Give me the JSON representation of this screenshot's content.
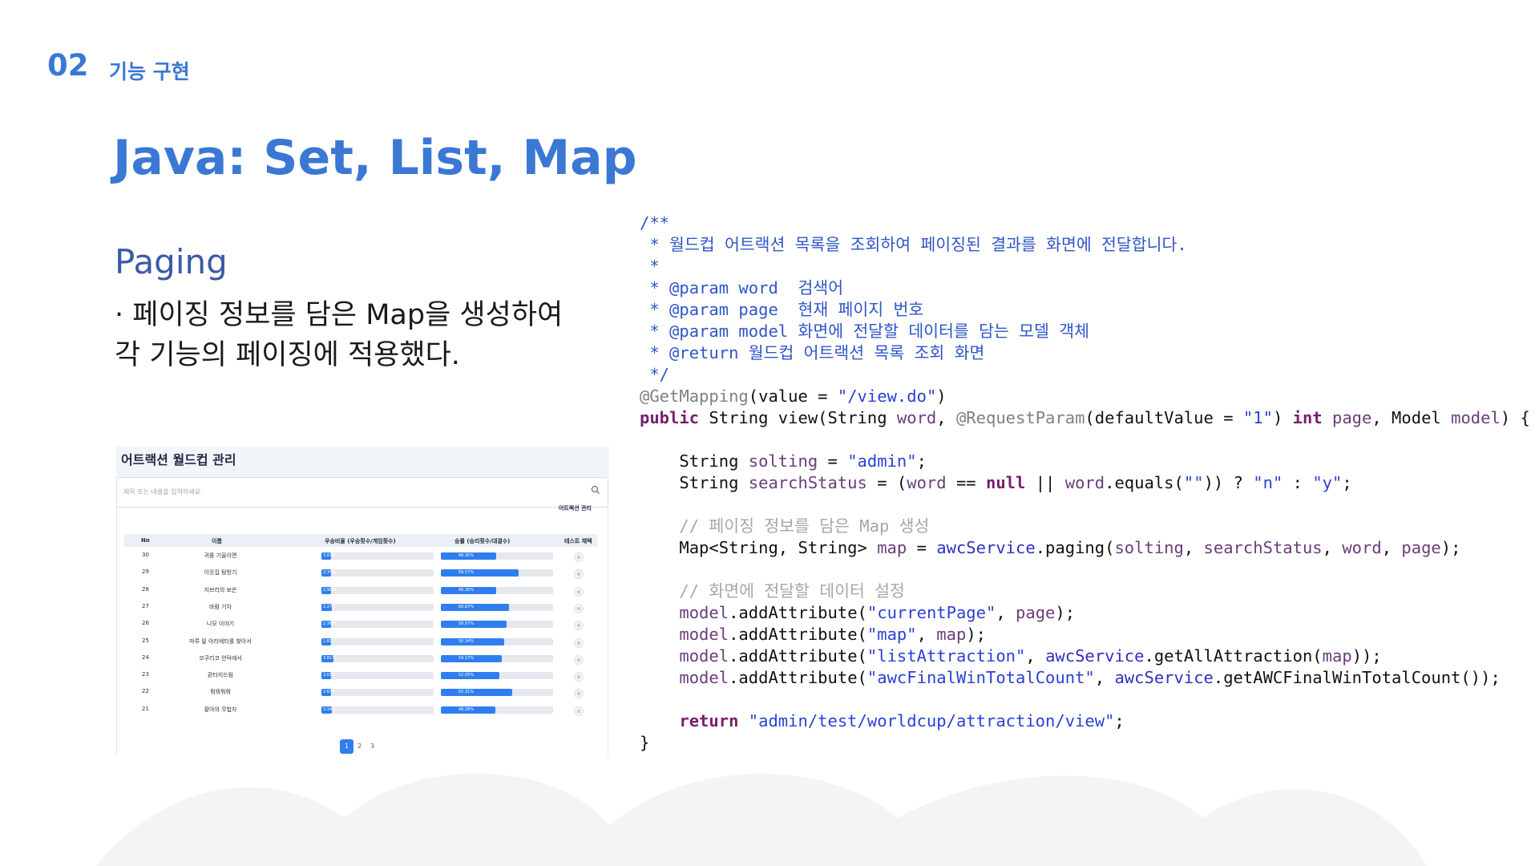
{
  "header": {
    "section_number": "02",
    "section_title": "기능 구현"
  },
  "title": "Java: Set, List, Map",
  "subtitle": "Paging",
  "description": {
    "line1": "· 페이징 정보를 담은 Map을 생성하여",
    "line2": "각 기능의 페이징에 적용했다."
  },
  "screenshot": {
    "title": "어트랙션 월드컵 관리",
    "search_placeholder": "제목 또는 내용을 입력하세요.",
    "manage_label": "어트랙션 관리",
    "columns": [
      "No",
      "이름",
      "우승비율 (우승횟수/게임횟수)",
      "승률 (승리횟수/대결수)",
      "테스트 채택"
    ],
    "rows": [
      {
        "no": "30",
        "name": "귀를 기울이면",
        "win_label": "3.07%",
        "win": 3.07,
        "rate_label": "49.30%",
        "rate": 49.3
      },
      {
        "no": "29",
        "name": "이웃집 탐방기",
        "win_label": "2.35%",
        "win": 2.35,
        "rate_label": "69.57%",
        "rate": 69.57
      },
      {
        "no": "28",
        "name": "지브리의 보은",
        "win_label": "2.98%",
        "win": 2.98,
        "rate_label": "49.30%",
        "rate": 49.3
      },
      {
        "no": "27",
        "name": "바람 기차",
        "win_label": "3.27%",
        "win": 3.27,
        "rate_label": "60.87%",
        "rate": 60.87
      },
      {
        "no": "26",
        "name": "니모 이야기",
        "win_label": "2.36%",
        "win": 2.36,
        "rate_label": "58.57%",
        "rate": 58.57
      },
      {
        "no": "25",
        "name": "마루 밑 아리에티를 찾아서",
        "win_label": "1.82",
        "win": 1.82,
        "rate_label": "56.34%",
        "rate": 56.34
      },
      {
        "no": "24",
        "name": "코쿠리코 언덕에서",
        "win_label": "3.81%",
        "win": 3.81,
        "rate_label": "54.17%",
        "rate": 54.17
      },
      {
        "no": "23",
        "name": "환타지드림",
        "win_label": "3.01%",
        "win": 3.01,
        "rate_label": "52.05%",
        "rate": 52.05
      },
      {
        "no": "22",
        "name": "뭐뭐뭐뭐",
        "win_label": "2.65%",
        "win": 2.65,
        "rate_label": "63.31%",
        "rate": 63.31
      },
      {
        "no": "21",
        "name": "황야의 무법자",
        "win_label": "3.34%",
        "win": 3.34,
        "rate_label": "48.28%",
        "rate": 48.28
      }
    ],
    "pages": [
      "1",
      "2",
      "3"
    ],
    "current_page": "1"
  },
  "code_lines": [
    [
      {
        "c": "cm",
        "t": "/**"
      }
    ],
    [
      {
        "c": "cm",
        "t": " * 월드컵 어트랙션 목록을 조회하여 페이징된 결과를 화면에 전달합니다."
      }
    ],
    [
      {
        "c": "cm",
        "t": " *"
      }
    ],
    [
      {
        "c": "cm",
        "t": " * @param word  검색어"
      }
    ],
    [
      {
        "c": "cm",
        "t": " * @param page  현재 페이지 번호"
      }
    ],
    [
      {
        "c": "cm",
        "t": " * @param model 화면에 전달할 데이터를 담는 모델 객체"
      }
    ],
    [
      {
        "c": "cm",
        "t": " * @return 월드컵 어트랙션 목록 조회 화면"
      }
    ],
    [
      {
        "c": "cm",
        "t": " */"
      }
    ],
    [
      {
        "c": "an",
        "t": "@GetMapping"
      },
      {
        "c": "",
        "t": "(value = "
      },
      {
        "c": "st",
        "t": "\"/view.do\""
      },
      {
        "c": "",
        "t": ")"
      }
    ],
    [
      {
        "c": "kw",
        "t": "public"
      },
      {
        "c": "",
        "t": " String view(String "
      },
      {
        "c": "va",
        "t": "word"
      },
      {
        "c": "",
        "t": ", "
      },
      {
        "c": "an",
        "t": "@RequestParam"
      },
      {
        "c": "",
        "t": "(defaultValue = "
      },
      {
        "c": "st",
        "t": "\"1\""
      },
      {
        "c": "",
        "t": ") "
      },
      {
        "c": "kw",
        "t": "int"
      },
      {
        "c": "",
        "t": " "
      },
      {
        "c": "va",
        "t": "page"
      },
      {
        "c": "",
        "t": ", Model "
      },
      {
        "c": "va",
        "t": "model"
      },
      {
        "c": "",
        "t": ") {"
      }
    ],
    [
      {
        "c": "",
        "t": ""
      }
    ],
    [
      {
        "c": "",
        "t": "    String "
      },
      {
        "c": "va",
        "t": "solting"
      },
      {
        "c": "",
        "t": " = "
      },
      {
        "c": "st",
        "t": "\"admin\""
      },
      {
        "c": "",
        "t": ";"
      }
    ],
    [
      {
        "c": "",
        "t": "    String "
      },
      {
        "c": "va",
        "t": "searchStatus"
      },
      {
        "c": "",
        "t": " = ("
      },
      {
        "c": "va",
        "t": "word"
      },
      {
        "c": "",
        "t": " == "
      },
      {
        "c": "kw",
        "t": "null"
      },
      {
        "c": "",
        "t": " || "
      },
      {
        "c": "va",
        "t": "word"
      },
      {
        "c": "",
        "t": ".equals("
      },
      {
        "c": "st",
        "t": "\"\""
      },
      {
        "c": "",
        "t": ")) ? "
      },
      {
        "c": "st",
        "t": "\"n\""
      },
      {
        "c": "",
        "t": " : "
      },
      {
        "c": "st",
        "t": "\"y\""
      },
      {
        "c": "",
        "t": ";"
      }
    ],
    [
      {
        "c": "",
        "t": ""
      }
    ],
    [
      {
        "c": "gc",
        "t": "    // 페이징 정보를 담은 Map 생성"
      }
    ],
    [
      {
        "c": "",
        "t": "    Map<String, String> "
      },
      {
        "c": "va",
        "t": "map"
      },
      {
        "c": "",
        "t": " = "
      },
      {
        "c": "fi",
        "t": "awcService"
      },
      {
        "c": "",
        "t": ".paging("
      },
      {
        "c": "va",
        "t": "solting"
      },
      {
        "c": "",
        "t": ", "
      },
      {
        "c": "va",
        "t": "searchStatus"
      },
      {
        "c": "",
        "t": ", "
      },
      {
        "c": "va",
        "t": "word"
      },
      {
        "c": "",
        "t": ", "
      },
      {
        "c": "va",
        "t": "page"
      },
      {
        "c": "",
        "t": ");"
      }
    ],
    [
      {
        "c": "",
        "t": ""
      }
    ],
    [
      {
        "c": "gc",
        "t": "    // 화면에 전달할 데이터 설정"
      }
    ],
    [
      {
        "c": "va",
        "t": "    model"
      },
      {
        "c": "",
        "t": ".addAttribute("
      },
      {
        "c": "st",
        "t": "\"currentPage\""
      },
      {
        "c": "",
        "t": ", "
      },
      {
        "c": "va",
        "t": "page"
      },
      {
        "c": "",
        "t": ");"
      }
    ],
    [
      {
        "c": "va",
        "t": "    model"
      },
      {
        "c": "",
        "t": ".addAttribute("
      },
      {
        "c": "st",
        "t": "\"map\""
      },
      {
        "c": "",
        "t": ", "
      },
      {
        "c": "va",
        "t": "map"
      },
      {
        "c": "",
        "t": ");"
      }
    ],
    [
      {
        "c": "va",
        "t": "    model"
      },
      {
        "c": "",
        "t": ".addAttribute("
      },
      {
        "c": "st",
        "t": "\"listAttraction\""
      },
      {
        "c": "",
        "t": ", "
      },
      {
        "c": "fi",
        "t": "awcService"
      },
      {
        "c": "",
        "t": ".getAllAttraction("
      },
      {
        "c": "va",
        "t": "map"
      },
      {
        "c": "",
        "t": "));"
      }
    ],
    [
      {
        "c": "va",
        "t": "    model"
      },
      {
        "c": "",
        "t": ".addAttribute("
      },
      {
        "c": "st",
        "t": "\"awcFinalWinTotalCount\""
      },
      {
        "c": "",
        "t": ", "
      },
      {
        "c": "fi",
        "t": "awcService"
      },
      {
        "c": "",
        "t": ".getAWCFinalWinTotalCount());"
      }
    ],
    [
      {
        "c": "",
        "t": ""
      }
    ],
    [
      {
        "c": "kw",
        "t": "    return"
      },
      {
        "c": "",
        "t": " "
      },
      {
        "c": "st",
        "t": "\"admin/test/worldcup/attraction/view\""
      },
      {
        "c": "",
        "t": ";"
      }
    ],
    [
      {
        "c": "",
        "t": "}"
      }
    ]
  ],
  "colors": {
    "accent": "#3a78d4",
    "subtitle": "#3a5aa8",
    "bar": "#2f7ef0",
    "wave": "#f3f4f6"
  }
}
